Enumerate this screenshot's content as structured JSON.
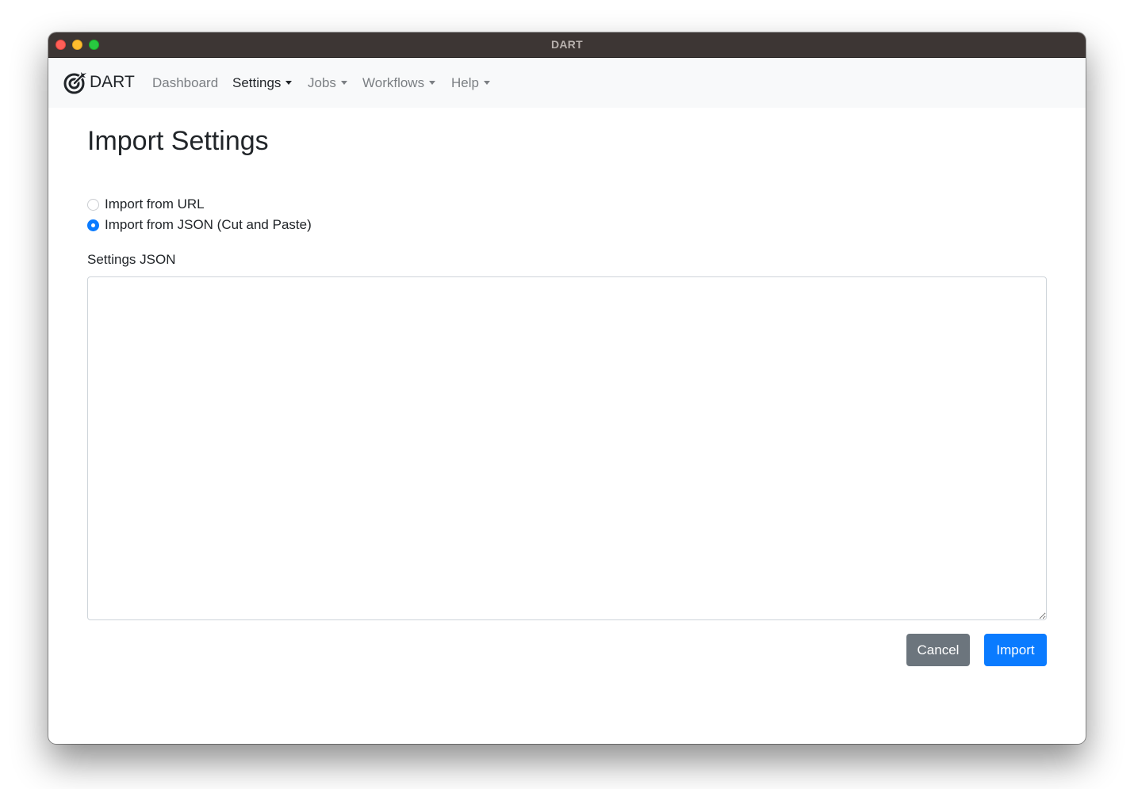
{
  "window": {
    "title": "DART"
  },
  "navbar": {
    "brand": "DART",
    "items": [
      {
        "label": "Dashboard",
        "has_dropdown": false,
        "active": false
      },
      {
        "label": "Settings",
        "has_dropdown": true,
        "active": true
      },
      {
        "label": "Jobs",
        "has_dropdown": true,
        "active": false
      },
      {
        "label": "Workflows",
        "has_dropdown": true,
        "active": false
      },
      {
        "label": "Help",
        "has_dropdown": true,
        "active": false
      }
    ]
  },
  "page": {
    "title": "Import Settings",
    "import_options": [
      {
        "label": "Import from URL",
        "checked": false
      },
      {
        "label": "Import from JSON (Cut and Paste)",
        "checked": true
      }
    ],
    "settings_json": {
      "label": "Settings JSON",
      "value": ""
    },
    "buttons": {
      "cancel_label": "Cancel",
      "import_label": "Import"
    }
  },
  "colors": {
    "primary": "#0a7bff",
    "secondary": "#6c757d",
    "titlebar": "#3d3634",
    "navbar_bg": "#f8f9fa"
  },
  "icons": {
    "brand": "bullseye-arrow-icon",
    "dropdown": "caret-down-icon"
  }
}
